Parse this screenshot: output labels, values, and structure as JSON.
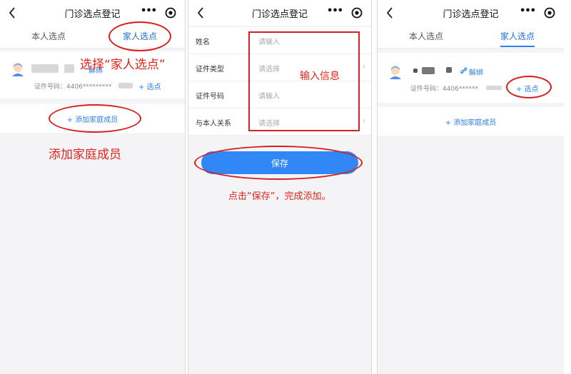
{
  "screens": [
    {
      "nav_title": "门诊选点登记",
      "tabs": [
        "本人选点",
        "家人选点"
      ],
      "member": {
        "unlink_label": "解绑",
        "id_prefix": "证件号码：4406*********",
        "select_label": "+ 选点"
      },
      "add_member_label": "+ 添加家庭成员",
      "annotation_tab": "选择“家人选点”",
      "annotation_add": "添加家庭成员"
    },
    {
      "nav_title": "门诊选点登记",
      "fields": [
        {
          "label": "姓名",
          "placeholder": "请输入",
          "has_arrow": false
        },
        {
          "label": "证件类型",
          "placeholder": "请选择",
          "has_arrow": true
        },
        {
          "label": "证件号码",
          "placeholder": "请输入",
          "has_arrow": false
        },
        {
          "label": "与本人关系",
          "placeholder": "请选择",
          "has_arrow": true
        }
      ],
      "arrow_glyph": "›",
      "save_label": "保存",
      "annotation_input": "输入信息",
      "annotation_save": "点击“保存”，完成添加。"
    },
    {
      "nav_title": "门诊选点登记",
      "tabs": [
        "本人选点",
        "家人选点"
      ],
      "member": {
        "unlink_label": "解绑",
        "id_prefix": "证件号码：4406******",
        "select_label": "+ 选点"
      },
      "add_member_label": "+ 添加家庭成员"
    }
  ],
  "icons": {
    "menu": "•••",
    "back": "back-chevron-icon",
    "capsule_target": "target-icon",
    "link": "link-icon"
  },
  "colors": {
    "accent": "#2b7ff0",
    "button": "#3187f5",
    "annotation": "#e0241c"
  }
}
